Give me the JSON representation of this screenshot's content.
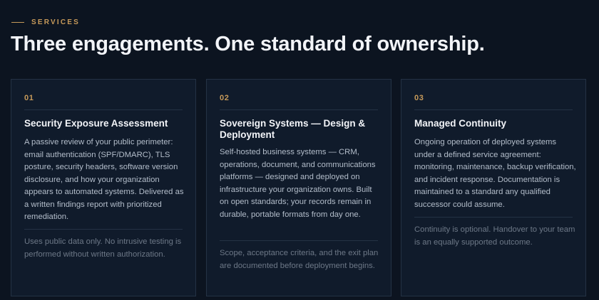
{
  "header": {
    "eyebrow": "SERVICES",
    "title": "Three engagements. One standard of ownership."
  },
  "cards": [
    {
      "number": "01",
      "title": "Security Exposure Assessment",
      "body": "A passive review of your public perimeter: email authentication (SPF/DMARC), TLS posture, security headers, software version disclosure, and how your organization appears to automated systems. Delivered as a written findings report with prioritized remediation.",
      "note": "Uses public data only. No intrusive testing is performed without written authorization."
    },
    {
      "number": "02",
      "title": "Sovereign Systems — Design & Deployment",
      "body": "Self-hosted business systems — CRM, operations, document, and communications platforms — designed and deployed on infrastructure your organization owns. Built on open standards; your records remain in durable, portable formats from day one.",
      "note": "Scope, acceptance criteria, and the exit plan are documented before deployment begins."
    },
    {
      "number": "03",
      "title": "Managed Continuity",
      "body": "Ongoing operation of deployed systems under a defined service agreement: monitoring, maintenance, backup verification, and incident response. Documentation is maintained to a standard any qualified successor could assume.",
      "note": "Continuity is optional. Handover to your team is an equally supported outcome."
    }
  ]
}
